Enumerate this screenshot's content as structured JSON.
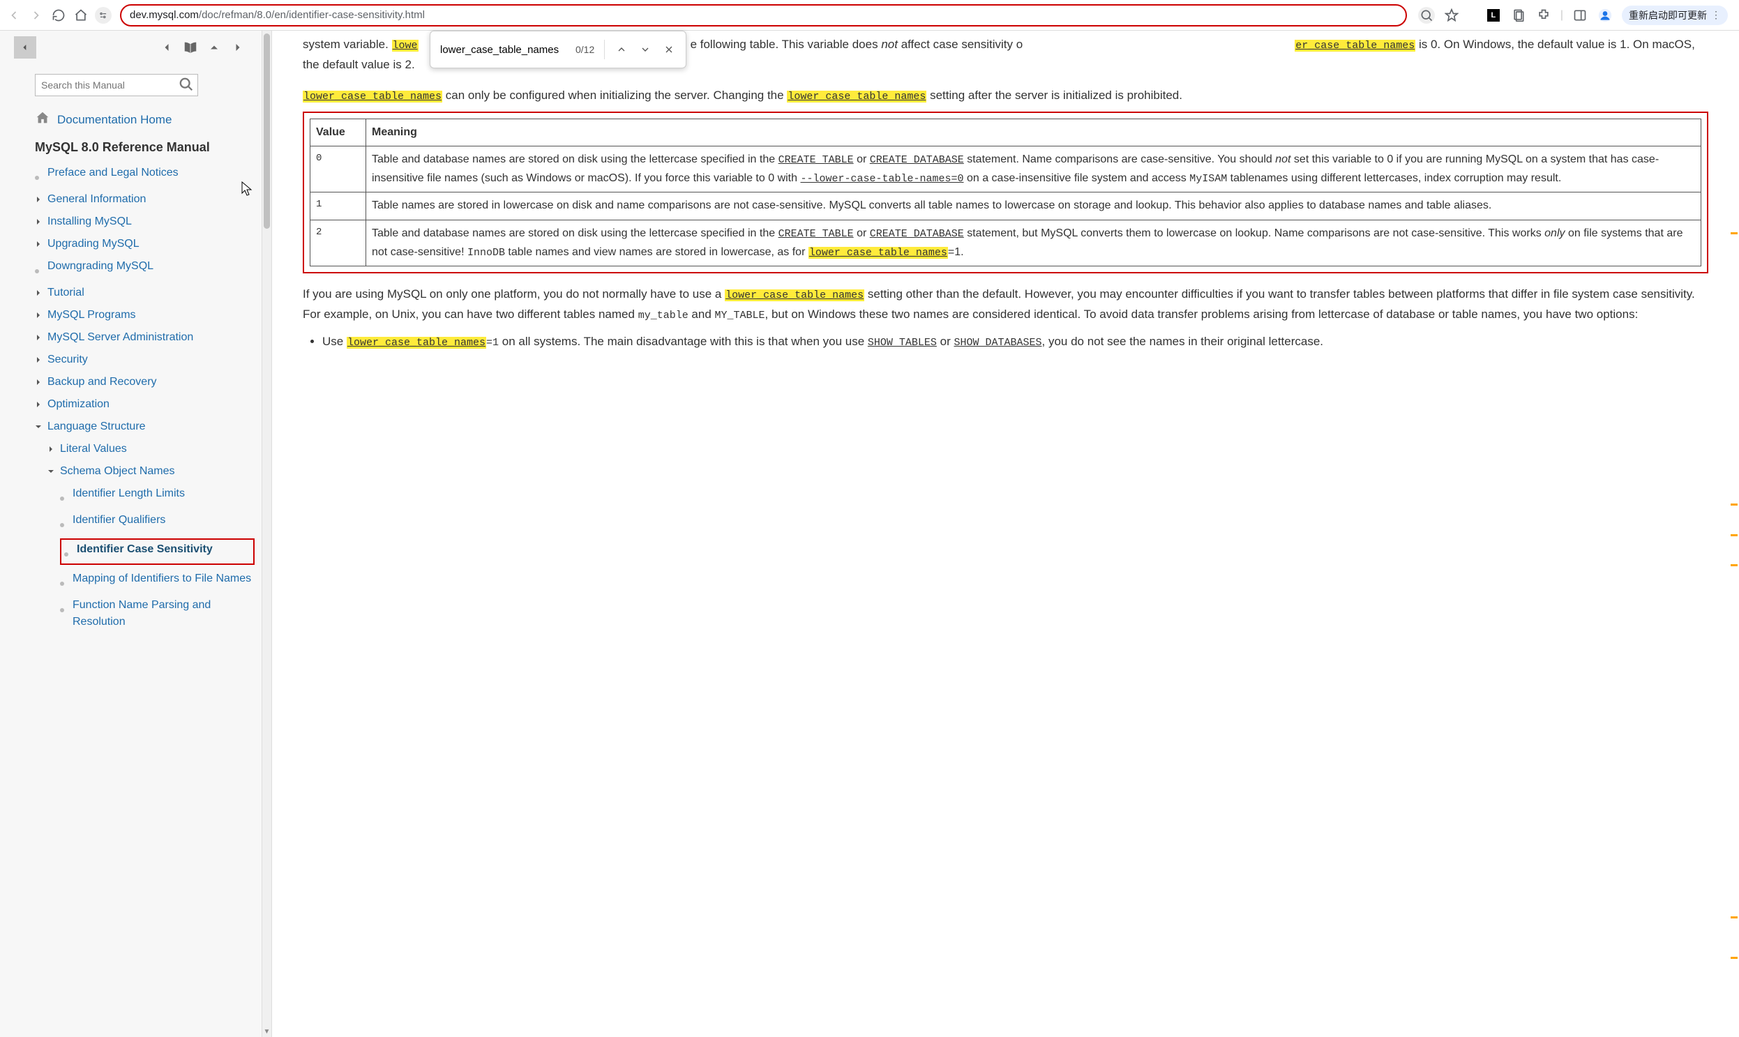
{
  "browser": {
    "url_host": "dev.mysql.com",
    "url_path": "/doc/refman/8.0/en/identifier-case-sensitivity.html",
    "update_label": "重新启动即可更新"
  },
  "find": {
    "query": "lower_case_table_names",
    "count": "0/12"
  },
  "sidebar": {
    "search_placeholder": "Search this Manual",
    "home_label": "Documentation Home",
    "manual_title": "MySQL 8.0 Reference Manual",
    "items": [
      {
        "label": "Preface and Legal Notices",
        "type": "leaf"
      },
      {
        "label": "General Information",
        "type": "caret"
      },
      {
        "label": "Installing MySQL",
        "type": "caret"
      },
      {
        "label": "Upgrading MySQL",
        "type": "caret"
      },
      {
        "label": "Downgrading MySQL",
        "type": "leaf"
      },
      {
        "label": "Tutorial",
        "type": "caret"
      },
      {
        "label": "MySQL Programs",
        "type": "caret"
      },
      {
        "label": "MySQL Server Administration",
        "type": "caret"
      },
      {
        "label": "Security",
        "type": "caret"
      },
      {
        "label": "Backup and Recovery",
        "type": "caret"
      },
      {
        "label": "Optimization",
        "type": "caret"
      },
      {
        "label": "Language Structure",
        "type": "caret-open"
      }
    ],
    "sub_items": [
      {
        "label": "Literal Values",
        "type": "caret"
      },
      {
        "label": "Schema Object Names",
        "type": "caret-open"
      }
    ],
    "sub2_items": [
      {
        "label": "Identifier Length Limits",
        "type": "leaf"
      },
      {
        "label": "Identifier Qualifiers",
        "type": "leaf"
      },
      {
        "label": "Identifier Case Sensitivity",
        "type": "leaf",
        "active": true
      },
      {
        "label": "Mapping of Identifiers to File Names",
        "type": "leaf"
      },
      {
        "label": "Function Name Parsing and Resolution",
        "type": "leaf"
      }
    ]
  },
  "content": {
    "p1_a": "system variable. ",
    "p1_hl1": "lowe",
    "p1_b": "e following table. This variable does ",
    "p1_not": "not",
    "p1_c": " affect case sensitivity o",
    "p1_hl2": "er_case_table_names",
    "p1_d": " is 0. On Windows, the default value is 1. On macOS, the default value is 2.",
    "p2_hl1": "lower_case_table_names",
    "p2_a": " can only be configured when initializing the server. Changing the ",
    "p2_hl2": "lower_case_table_names",
    "p2_b": " setting after the server is initialized is prohibited.",
    "th_value": "Value",
    "th_meaning": "Meaning",
    "r0_v": "0",
    "r0_a": "Table and database names are stored on disk using the lettercase specified in the ",
    "r0_ct": "CREATE TABLE",
    "r0_or": " or ",
    "r0_cd": "CREATE DATABASE",
    "r0_b": " statement. Name comparisons are case-sensitive. You should ",
    "r0_not": "not",
    "r0_c": " set this variable to 0 if you are running MySQL on a system that has case-insensitive file names (such as Windows or macOS). If you force this variable to 0 with ",
    "r0_opt": "--lower-case-table-names=0",
    "r0_d": " on a case-insensitive file system and access ",
    "r0_myisam": "MyISAM",
    "r0_e": " tablenames using different lettercases, index corruption may result.",
    "r1_v": "1",
    "r1_a": "Table names are stored in lowercase on disk and name comparisons are not case-sensitive. MySQL converts all table names to lowercase on storage and lookup. This behavior also applies to database names and table aliases.",
    "r2_v": "2",
    "r2_a": "Table and database names are stored on disk using the lettercase specified in the ",
    "r2_ct": "CREATE TABLE",
    "r2_or": " or ",
    "r2_cd": "CREATE DATABASE",
    "r2_b": " statement, but MySQL converts them to lowercase on lookup. Name comparisons are not case-sensitive. This works ",
    "r2_only": "only",
    "r2_c": " on file systems that are not case-sensitive! ",
    "r2_innodb": "InnoDB",
    "r2_d": " table names and view names are stored in lowercase, as for ",
    "r2_hl": "lower_case_table_names",
    "r2_e": "=1.",
    "p3_a": "If you are using MySQL on only one platform, you do not normally have to use a ",
    "p3_hl": "lower_case_table_names",
    "p3_b": " setting other than the default. However, you may encounter difficulties if you want to transfer tables between platforms that differ in file system case sensitivity. For example, on Unix, you can have two different tables named ",
    "p3_mt": "my_table",
    "p3_c": " and ",
    "p3_MT": "MY_TABLE",
    "p3_d": ", but on Windows these two names are considered identical. To avoid data transfer problems arising from lettercase of database or table names, you have two options:",
    "li1_a": "Use ",
    "li1_hl": "lower_case_table_names",
    "li1_eq": "=1",
    "li1_b": " on all systems. The main disadvantage with this is that when you use ",
    "li1_st": "SHOW TABLES",
    "li1_or": " or ",
    "li1_sd": "SHOW DATABASES",
    "li1_c": ", you do not see the names in their original lettercase."
  }
}
